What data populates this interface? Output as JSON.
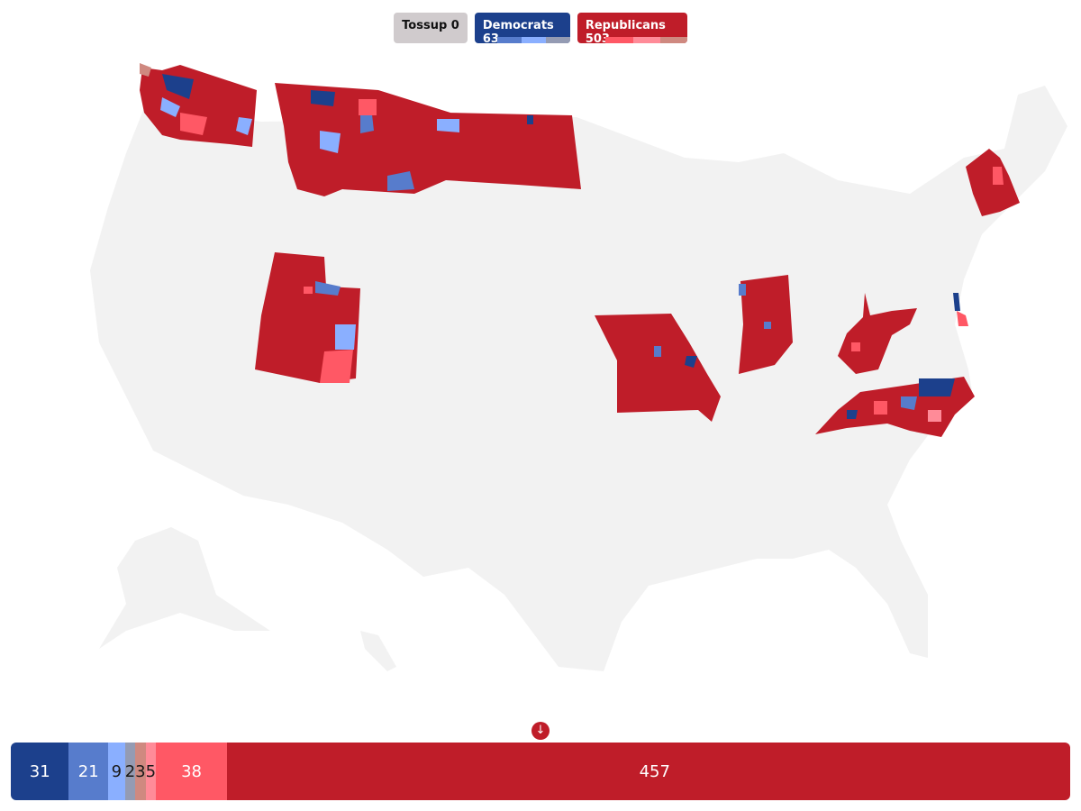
{
  "legend": {
    "tossup": {
      "label": "Tossup 0",
      "color": "#d0cbcd"
    },
    "democrats": {
      "label": "Democrats 63",
      "color": "#1c408c",
      "shades": [
        "#577ccc",
        "#8aafff",
        "#949bb3"
      ]
    },
    "republicans": {
      "label": "Republicans 503",
      "color": "#bf1d29",
      "shades": [
        "#ff5865",
        "#ff8b98",
        "#cf8980"
      ]
    }
  },
  "arrow_icon": "arrow-down-circle-icon",
  "seat_bar": [
    {
      "label": "31",
      "value": 31,
      "color": "#1c408c",
      "text_color": "#ffffff"
    },
    {
      "label": "21",
      "value": 21,
      "color": "#577ccc",
      "text_color": "#ffffff"
    },
    {
      "label": "9",
      "value": 9,
      "color": "#8aafff",
      "text_color": "#1a1a1a"
    },
    {
      "label": "2",
      "value": 2,
      "color": "#949bb3",
      "text_color": "#1a1a1a"
    },
    {
      "label": "3",
      "value": 3,
      "color": "#cf8980",
      "text_color": "#1a1a1a"
    },
    {
      "label": "5",
      "value": 5,
      "color": "#ff8b98",
      "text_color": "#1a1a1a"
    },
    {
      "label": "38",
      "value": 38,
      "color": "#ff5865",
      "text_color": "#ffffff"
    },
    {
      "label": "457",
      "value": 457,
      "color": "#bf1d29",
      "text_color": "#ffffff"
    }
  ],
  "states_shown": [
    "Washington",
    "Montana",
    "North Dakota",
    "Utah",
    "Missouri",
    "Indiana",
    "West Virginia",
    "North Carolina",
    "Delaware",
    "New Hampshire"
  ]
}
